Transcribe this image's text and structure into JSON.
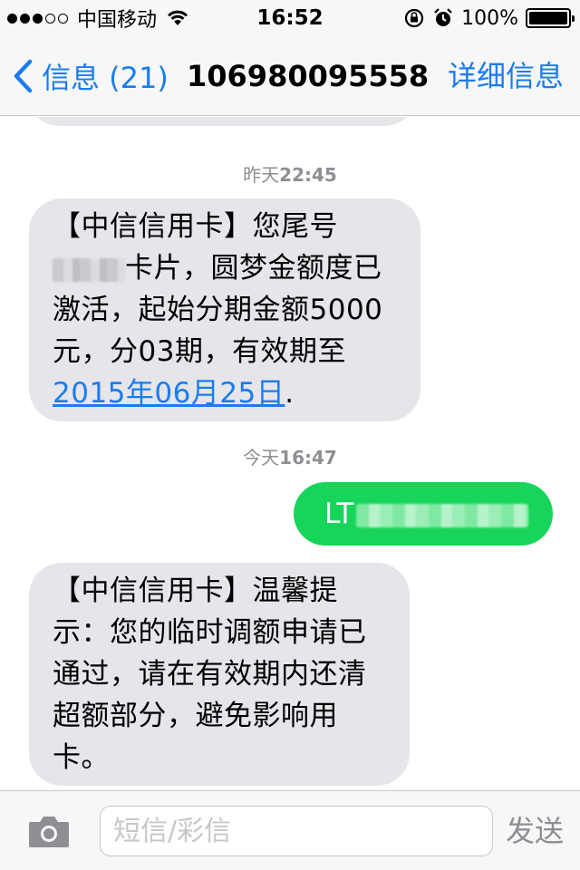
{
  "status_bar": {
    "signal_full": 3,
    "signal_empty": 2,
    "carrier": "中国移动",
    "time": "16:52",
    "battery": "100%",
    "battery_level": 1.0
  },
  "nav": {
    "back_label": "信息 (21)",
    "title": "106980095558",
    "detail_label": "详细信息"
  },
  "messages": [
    {
      "timestamp_day": "昨天",
      "timestamp_time": "22:45"
    },
    {
      "type": "incoming",
      "line1": "【中信信用卡】您尾号",
      "line2_after_redaction": "卡片，圆梦金额度已",
      "line3": "激活，起始分期金额5000",
      "line4": "元，分03期，有效期至",
      "link": "2015年06月25日",
      "link_suffix": "."
    },
    {
      "timestamp_day": "今天",
      "timestamp_time": "16:47"
    },
    {
      "type": "outgoing",
      "text_prefix": "LT"
    },
    {
      "type": "incoming",
      "line1": "【中信信用卡】温馨提",
      "line2": "示：您的临时调额申请已",
      "line3": "通过，请在有效期内还清",
      "line4": "超额部分，避免影响用",
      "line5": "卡。"
    }
  ],
  "input": {
    "placeholder": "短信/彩信",
    "send_label": "发送"
  },
  "colors": {
    "ios_blue": "#1a7cf0",
    "incoming_bubble": "#e5e5ea",
    "outgoing_bubble": "#17d55a",
    "bar_bg": "#f7f7f8"
  },
  "icons": [
    "wifi-icon",
    "chevron-left-icon",
    "rotation-lock-icon",
    "alarm-icon",
    "battery-icon",
    "camera-icon"
  ]
}
